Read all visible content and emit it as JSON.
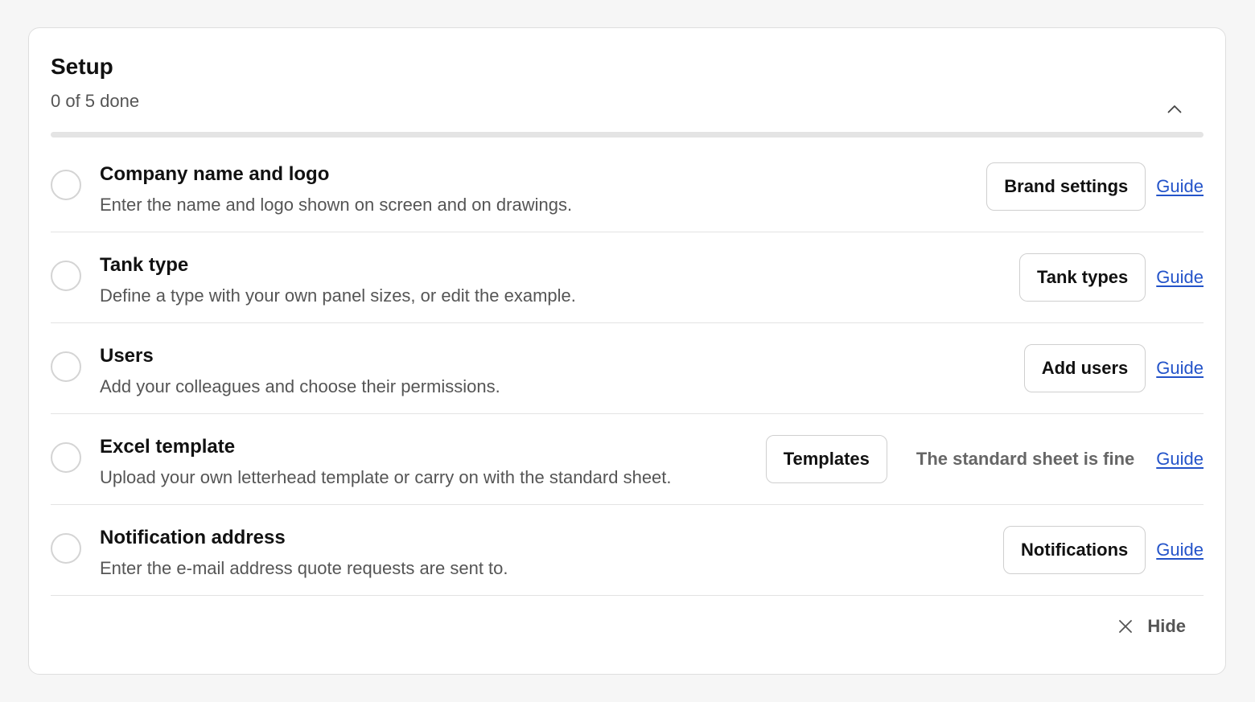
{
  "setup": {
    "title": "Setup",
    "progress_text": "0 of 5 done",
    "progress_fraction": 0,
    "collapse_icon": "chevron-up-icon",
    "tasks": [
      {
        "title": "Company name and logo",
        "description": "Enter the name and logo shown on screen and on drawings.",
        "action_label": "Brand settings",
        "guide_label": "Guide",
        "done": false
      },
      {
        "title": "Tank type",
        "description": "Define a type with your own panel sizes, or edit the example.",
        "action_label": "Tank types",
        "guide_label": "Guide",
        "done": false
      },
      {
        "title": "Users",
        "description": "Add your colleagues and choose their permissions.",
        "action_label": "Add users",
        "guide_label": "Guide",
        "done": false
      },
      {
        "title": "Excel template",
        "description": "Upload your own letterhead template or carry on with the standard sheet.",
        "action_label": "Templates",
        "skip_label": "The standard sheet is fine",
        "guide_label": "Guide",
        "done": false
      },
      {
        "title": "Notification address",
        "description": "Enter the e-mail address quote requests are sent to.",
        "action_label": "Notifications",
        "guide_label": "Guide",
        "done": false
      }
    ],
    "hide_label": "Hide",
    "hide_icon": "close-icon"
  },
  "colors": {
    "page_background": "#f6f6f6",
    "card_background": "#ffffff",
    "link": "#2353c9",
    "progress_track": "#e4e4e4"
  }
}
